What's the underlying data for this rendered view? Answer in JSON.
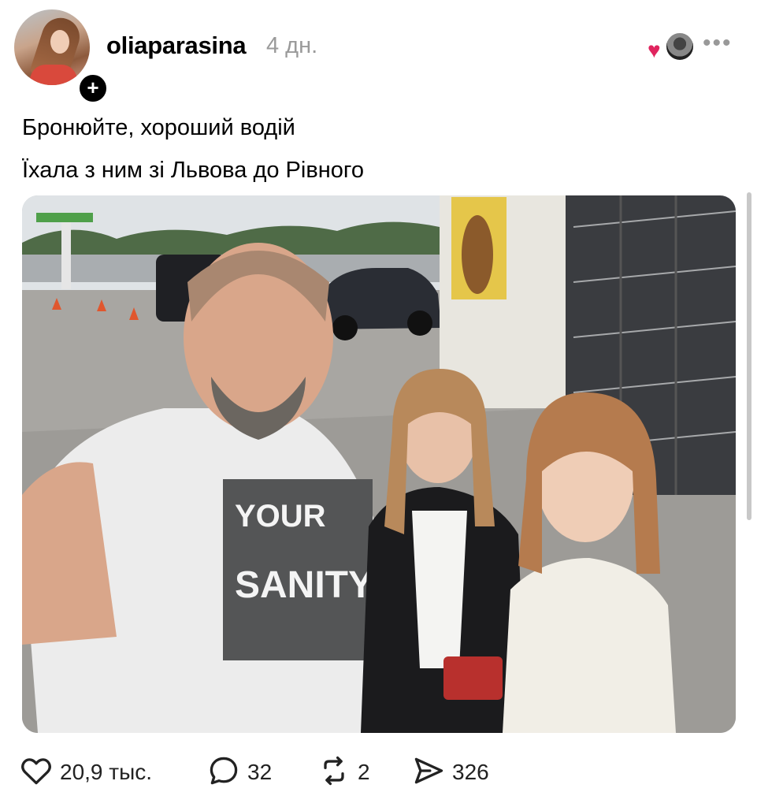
{
  "post": {
    "username": "oliaparasina",
    "timestamp": "4 дн.",
    "follow_symbol": "+",
    "more_symbol": "•••",
    "text_lines": [
      "Бронюйте, хороший водій",
      "Їхала з ним зі Львова до Рівного"
    ]
  },
  "actions": {
    "likes": "20,9 тыс.",
    "comments": "32",
    "reposts": "2",
    "shares": "326"
  },
  "icons": {
    "like": "heart-outline-icon",
    "comment": "speech-bubble-icon",
    "repost": "repost-arrows-icon",
    "share": "paper-plane-icon",
    "reaction": "heart-icon"
  },
  "colors": {
    "heart": "#e0245e",
    "muted": "#9a9a9a"
  }
}
